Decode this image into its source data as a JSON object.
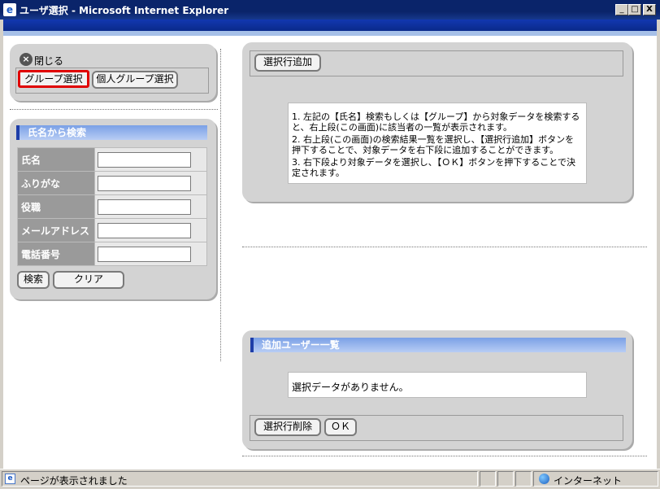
{
  "window": {
    "title": "ユーザ選択 - Microsoft Internet Explorer",
    "minimize": "_",
    "maximize": "□",
    "close": "X"
  },
  "left_panel": {
    "close_label": "閉じる",
    "tab_group": "グループ選択",
    "tab_personal_group": "個人グループ選択"
  },
  "search_panel": {
    "header": "氏名から検索",
    "fields": [
      {
        "label": "氏名",
        "value": ""
      },
      {
        "label": "ふりがな",
        "value": ""
      },
      {
        "label": "役職",
        "value": ""
      },
      {
        "label": "メールアドレス",
        "value": ""
      },
      {
        "label": "電話番号",
        "value": ""
      }
    ],
    "search_button": "検索",
    "clear_button": "クリア"
  },
  "right_top_panel": {
    "add_row_button": "選択行追加",
    "instructions": [
      "1. 左記の【氏名】検索もしくは【グループ】から対象データを検索すると、右上段(この画面)に該当者の一覧が表示されます。",
      "2. 右上段(この画面)の検索結果一覧を選択し、【選択行追加】ボタンを押下することで、対象データを右下段に追加することができます。",
      "3. 右下段より対象データを選択し、【ＯＫ】ボタンを押下することで決定されます。"
    ]
  },
  "right_bottom_panel": {
    "header": "追加ユーザー一覧",
    "empty_message": "選択データがありません。",
    "delete_row_button": "選択行削除",
    "ok_button": "ＯＫ"
  },
  "statusbar": {
    "message": "ページが表示されました",
    "zone": "インターネット"
  },
  "colors": {
    "titlebar": "#0a246a",
    "panel_bg": "#d3d3d3",
    "header_blue": "#7aa0e6",
    "selected_tab_border": "#e00000"
  }
}
